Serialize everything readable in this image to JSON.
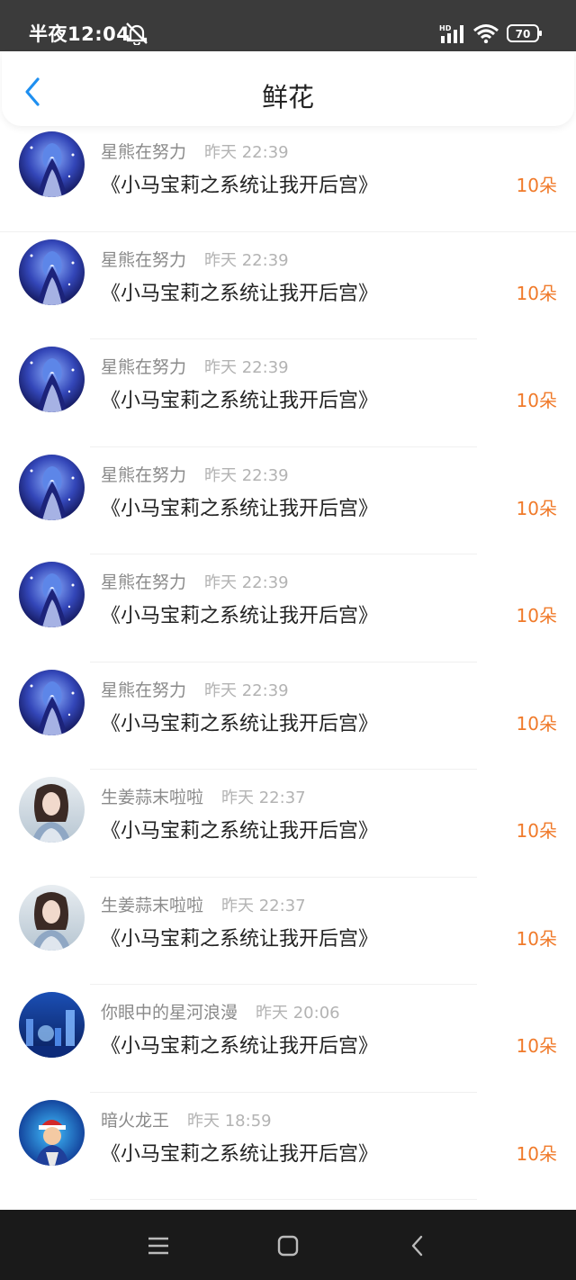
{
  "status_bar": {
    "time": "半夜12:04",
    "battery": "70",
    "network": "HD"
  },
  "header": {
    "title": "鲜花"
  },
  "rows": [
    {
      "user": "星熊在努力",
      "time": "昨天 22:39",
      "book": "《小马宝莉之系统让我开后宫》",
      "count": "10朵",
      "avatar": "anime-blue"
    },
    {
      "user": "星熊在努力",
      "time": "昨天 22:39",
      "book": "《小马宝莉之系统让我开后宫》",
      "count": "10朵",
      "avatar": "anime-blue"
    },
    {
      "user": "星熊在努力",
      "time": "昨天 22:39",
      "book": "《小马宝莉之系统让我开后宫》",
      "count": "10朵",
      "avatar": "anime-blue"
    },
    {
      "user": "星熊在努力",
      "time": "昨天 22:39",
      "book": "《小马宝莉之系统让我开后宫》",
      "count": "10朵",
      "avatar": "anime-blue"
    },
    {
      "user": "星熊在努力",
      "time": "昨天 22:39",
      "book": "《小马宝莉之系统让我开后宫》",
      "count": "10朵",
      "avatar": "anime-blue"
    },
    {
      "user": "星熊在努力",
      "time": "昨天 22:39",
      "book": "《小马宝莉之系统让我开后宫》",
      "count": "10朵",
      "avatar": "anime-blue"
    },
    {
      "user": "生姜蒜末啦啦",
      "time": "昨天 22:37",
      "book": "《小马宝莉之系统让我开后宫》",
      "count": "10朵",
      "avatar": "lady-portrait"
    },
    {
      "user": "生姜蒜末啦啦",
      "time": "昨天 22:37",
      "book": "《小马宝莉之系统让我开后宫》",
      "count": "10朵",
      "avatar": "lady-portrait"
    },
    {
      "user": "你眼中的星河浪漫",
      "time": "昨天 20:06",
      "book": "《小马宝莉之系统让我开后宫》",
      "count": "10朵",
      "avatar": "night-city"
    },
    {
      "user": "暗火龙王",
      "time": "昨天 18:59",
      "book": "《小马宝莉之系统让我开后宫》",
      "count": "10朵",
      "avatar": "cartoon-trainer"
    }
  ],
  "colors": {
    "accent_orange": "#f07a2a",
    "back_blue": "#1e8ff0",
    "status_bar": "#3b3b3b",
    "nav_bar": "#1a1a1a"
  },
  "icons": {
    "back": "chevron-left-icon",
    "mute": "bell-off-icon",
    "signal": "signal-icon",
    "wifi": "wifi-icon",
    "battery": "battery-icon",
    "menu": "menu-icon",
    "home": "home-icon",
    "nav_back": "nav-back-icon"
  }
}
